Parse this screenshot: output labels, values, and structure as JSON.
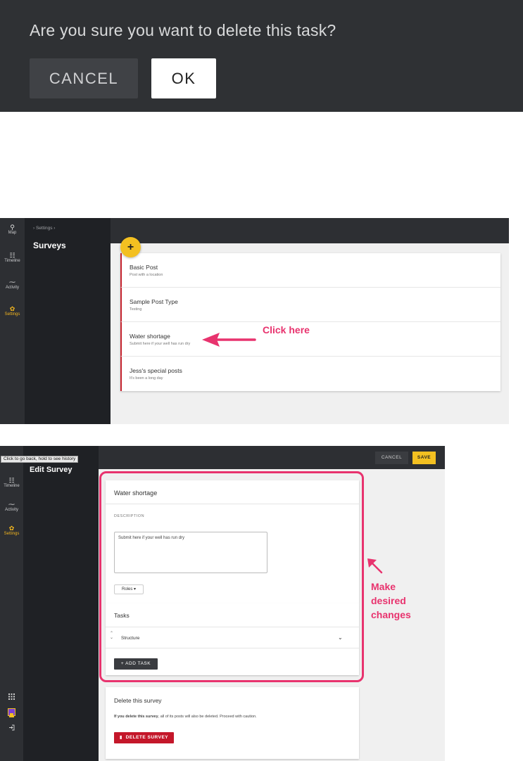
{
  "dialog": {
    "question": "Are you sure you want to delete this task?",
    "cancel_label": "CANCEL",
    "ok_label": "OK"
  },
  "nav": [
    {
      "label": "Map",
      "icon": "map-pin-icon",
      "glyph": "⚲"
    },
    {
      "label": "Timeline",
      "icon": "timeline-icon",
      "glyph": "☷"
    },
    {
      "label": "Activity",
      "icon": "activity-icon",
      "glyph": "⁓"
    },
    {
      "label": "Settings",
      "icon": "gear-icon",
      "glyph": "✿",
      "active": true
    }
  ],
  "surveys_page": {
    "breadcrumb": "›  Settings  ›",
    "title": "Surveys",
    "add_glyph": "+",
    "items": [
      {
        "title": "Basic Post",
        "subtitle": "Post with a location"
      },
      {
        "title": "Sample Post Type",
        "subtitle": "Testing"
      },
      {
        "title": "Water shortage",
        "subtitle": "Submit here if your well has run dry"
      },
      {
        "title": "Jess's special posts",
        "subtitle": "It's been a long day"
      }
    ],
    "annotation": "Click here"
  },
  "edit_page": {
    "tooltip": "Click to go back, hold to see history",
    "title": "Edit Survey",
    "cancel_label": "CANCEL",
    "save_label": "SAVE",
    "survey_name": "Water shortage",
    "description_label": "DESCRIPTION",
    "description_value": "Submit here if your well has run dry",
    "roles_label": "Roles",
    "tasks_heading": "Tasks",
    "task_name": "Structure",
    "add_task_label": "+ ADD TASK",
    "delete_heading": "Delete this survey",
    "delete_warning_bold": "If you delete this survey",
    "delete_warning_rest": ", all of its posts will also be deleted. Proceed with caution.",
    "delete_button_label": "DELETE SURVEY",
    "annotation_lines": [
      "Make",
      "desired",
      "changes"
    ],
    "bottom_icons": [
      "apps-grid-icon",
      "avatar",
      "logout-icon"
    ]
  },
  "colors": {
    "accent": "#f3c021",
    "danger": "#c4172a",
    "annotation": "#e8336e",
    "rail": "#2d2f33"
  }
}
